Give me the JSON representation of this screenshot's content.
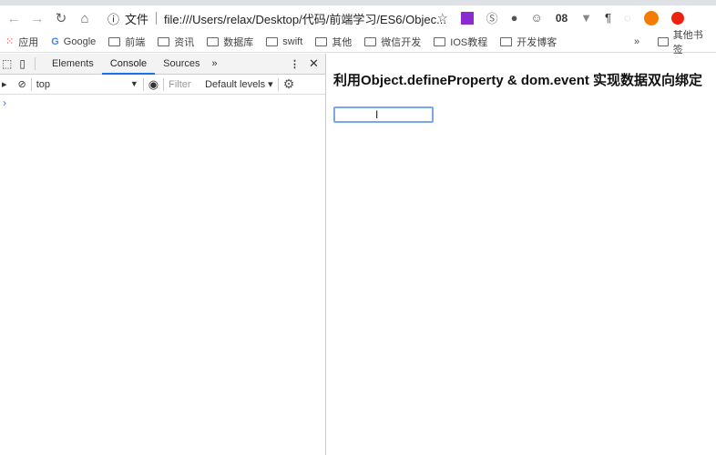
{
  "browser": {
    "url_label": "文件",
    "url": "file:///Users/relax/Desktop/代码/前端学习/ES6/Objec...",
    "ext_badge": "08"
  },
  "bookmarks": {
    "apps": "应用",
    "items": [
      "Google",
      "前端",
      "资讯",
      "数据库",
      "swift",
      "其他",
      "微信开发",
      "IOS教程",
      "开发博客"
    ],
    "more": "»",
    "other": "其他书签"
  },
  "devtools": {
    "tabs": [
      "Elements",
      "Console",
      "Sources"
    ],
    "more": "»",
    "context": "top",
    "filter_placeholder": "Filter",
    "levels": "Default levels ▾",
    "prompt": "›"
  },
  "page": {
    "heading": "利用Object.defineProperty & dom.event 实现数据双向绑定",
    "input_value": ""
  }
}
